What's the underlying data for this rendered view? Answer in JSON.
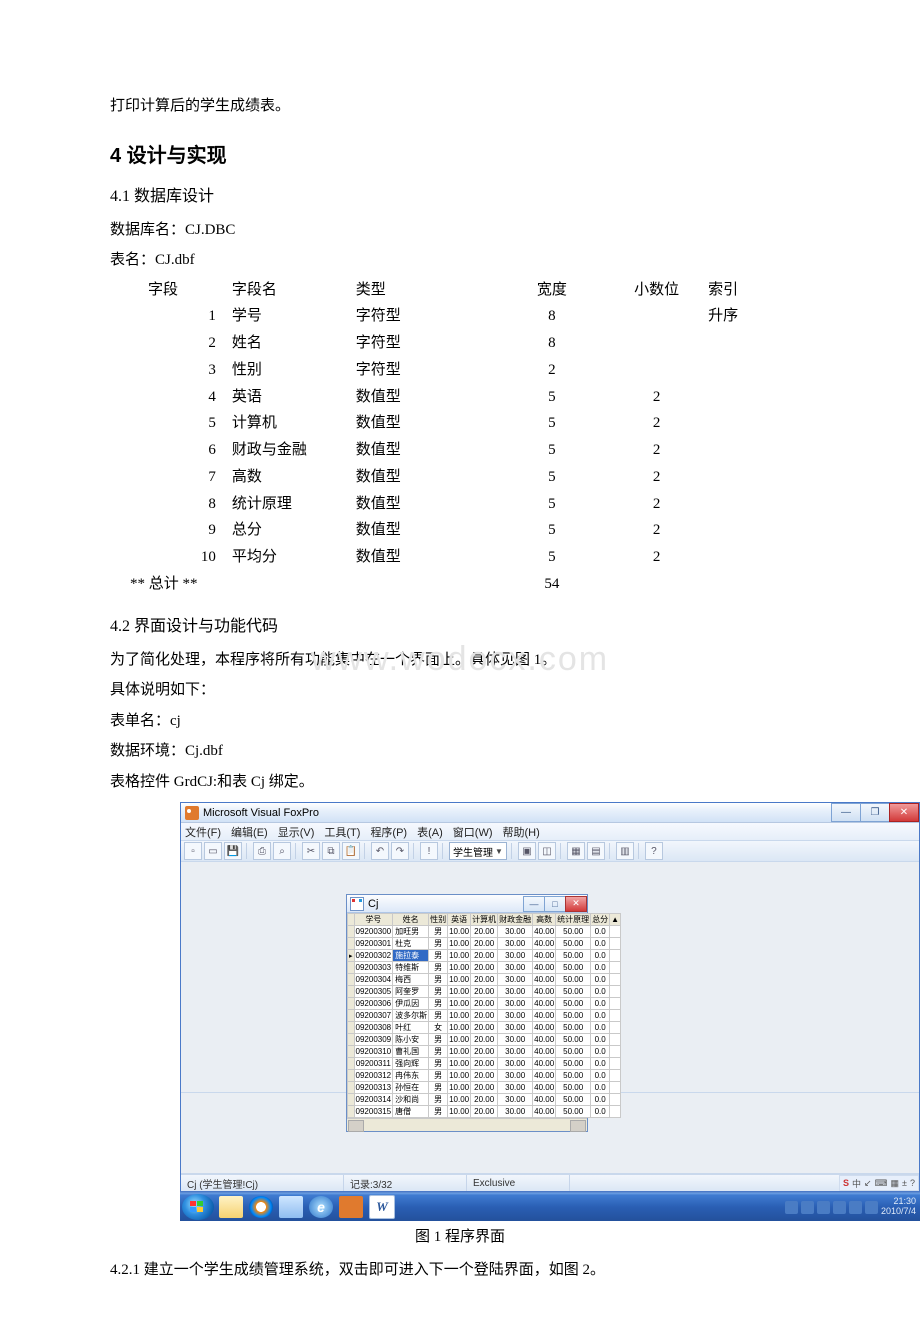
{
  "document": {
    "line_print": "打印计算后的学生成绩表。",
    "h_design": "4  设计与实现",
    "h_db": "4.1  数据库设计",
    "db_name_label": "数据库名：CJ.DBC",
    "table_name_label": "表名：CJ.dbf",
    "fields_header": {
      "col0": "字段",
      "col1": "字段名",
      "col2": "类型",
      "col3": "宽度",
      "col4": "小数位",
      "col5": "索引"
    },
    "fields": [
      {
        "n": "1",
        "name": "学号",
        "type": "字符型",
        "w": "8",
        "d": "",
        "idx": "升序"
      },
      {
        "n": "2",
        "name": "姓名",
        "type": "字符型",
        "w": "8",
        "d": "",
        "idx": ""
      },
      {
        "n": "3",
        "name": "性别",
        "type": "字符型",
        "w": "2",
        "d": "",
        "idx": ""
      },
      {
        "n": "4",
        "name": "英语",
        "type": "数值型",
        "w": "5",
        "d": "2",
        "idx": ""
      },
      {
        "n": "5",
        "name": "计算机",
        "type": "数值型",
        "w": "5",
        "d": "2",
        "idx": ""
      },
      {
        "n": "6",
        "name": "财政与金融",
        "type": "数值型",
        "w": "5",
        "d": "2",
        "idx": ""
      },
      {
        "n": "7",
        "name": "高数",
        "type": "数值型",
        "w": "5",
        "d": "2",
        "idx": ""
      },
      {
        "n": "8",
        "name": "统计原理",
        "type": "数值型",
        "w": "5",
        "d": "2",
        "idx": ""
      },
      {
        "n": "9",
        "name": "总分",
        "type": "数值型",
        "w": "5",
        "d": "2",
        "idx": ""
      },
      {
        "n": "10",
        "name": "平均分",
        "type": "数值型",
        "w": "5",
        "d": "2",
        "idx": ""
      }
    ],
    "total_row": {
      "label": "**  总计  **",
      "w": "54"
    },
    "h_ui": "4.2  界面设计与功能代码",
    "p_ui1": "为了简化处理，本程序将所有功能集中在一个界面上。具体见图 1。",
    "p_ui2": "具体说明如下：",
    "p_ui3": "表单名：cj",
    "p_ui4": "数据环境：Cj.dbf",
    "p_ui5": "表格控件 GrdCJ:和表 Cj 绑定。",
    "watermark": "www.wodocx.com",
    "figcap": "图 1    程序界面",
    "p_421": "4.2.1  建立一个学生成绩管理系统，双击即可进入下一个登陆界面，如图 2。"
  },
  "vfp": {
    "title": "Microsoft Visual FoxPro",
    "menu": [
      "文件(F)",
      "编辑(E)",
      "显示(V)",
      "工具(T)",
      "程序(P)",
      "表(A)",
      "窗口(W)",
      "帮助(H)"
    ],
    "combo": "学生管理",
    "status_left": "Cj (学生管理!Cj)",
    "status_rec": "记录:3/32",
    "status_mode": "Exclusive",
    "lang": {
      "s": "S",
      "ch": "中"
    },
    "tray_time": "21:30",
    "tray_date": "2010/7/4",
    "cj_title": "Cj",
    "grid_headers": [
      "",
      "学号",
      "姓名",
      "性别",
      "英语",
      "计算机",
      "财政金融",
      "高数",
      "统计原理",
      "总分"
    ],
    "grid_rows": [
      {
        "id": "09200300",
        "name": "加旺男",
        "sex": "男",
        "a": "10.00",
        "b": "20.00",
        "c": "30.00",
        "d": "40.00",
        "e": "50.00",
        "f": "0.0"
      },
      {
        "id": "09200301",
        "name": "杜克",
        "sex": "男",
        "a": "10.00",
        "b": "20.00",
        "c": "30.00",
        "d": "40.00",
        "e": "50.00",
        "f": "0.0"
      },
      {
        "id": "09200302",
        "name": "施拉泰",
        "sex": "男",
        "a": "10.00",
        "b": "20.00",
        "c": "30.00",
        "d": "40.00",
        "e": "50.00",
        "f": "0.0",
        "sel": true
      },
      {
        "id": "09200303",
        "name": "特维斯",
        "sex": "男",
        "a": "10.00",
        "b": "20.00",
        "c": "30.00",
        "d": "40.00",
        "e": "50.00",
        "f": "0.0"
      },
      {
        "id": "09200304",
        "name": "梅西",
        "sex": "男",
        "a": "10.00",
        "b": "20.00",
        "c": "30.00",
        "d": "40.00",
        "e": "50.00",
        "f": "0.0"
      },
      {
        "id": "09200305",
        "name": "阿奎罗",
        "sex": "男",
        "a": "10.00",
        "b": "20.00",
        "c": "30.00",
        "d": "40.00",
        "e": "50.00",
        "f": "0.0"
      },
      {
        "id": "09200306",
        "name": "伊瓜因",
        "sex": "男",
        "a": "10.00",
        "b": "20.00",
        "c": "30.00",
        "d": "40.00",
        "e": "50.00",
        "f": "0.0"
      },
      {
        "id": "09200307",
        "name": "波多尔斯",
        "sex": "男",
        "a": "10.00",
        "b": "20.00",
        "c": "30.00",
        "d": "40.00",
        "e": "50.00",
        "f": "0.0"
      },
      {
        "id": "09200308",
        "name": "叶红",
        "sex": "女",
        "a": "10.00",
        "b": "20.00",
        "c": "30.00",
        "d": "40.00",
        "e": "50.00",
        "f": "0.0"
      },
      {
        "id": "09200309",
        "name": "陈小安",
        "sex": "男",
        "a": "10.00",
        "b": "20.00",
        "c": "30.00",
        "d": "40.00",
        "e": "50.00",
        "f": "0.0"
      },
      {
        "id": "09200310",
        "name": "曹礼国",
        "sex": "男",
        "a": "10.00",
        "b": "20.00",
        "c": "30.00",
        "d": "40.00",
        "e": "50.00",
        "f": "0.0"
      },
      {
        "id": "09200311",
        "name": "强向辉",
        "sex": "男",
        "a": "10.00",
        "b": "20.00",
        "c": "30.00",
        "d": "40.00",
        "e": "50.00",
        "f": "0.0"
      },
      {
        "id": "09200312",
        "name": "冉伟东",
        "sex": "男",
        "a": "10.00",
        "b": "20.00",
        "c": "30.00",
        "d": "40.00",
        "e": "50.00",
        "f": "0.0"
      },
      {
        "id": "09200313",
        "name": "孙恒在",
        "sex": "男",
        "a": "10.00",
        "b": "20.00",
        "c": "30.00",
        "d": "40.00",
        "e": "50.00",
        "f": "0.0"
      },
      {
        "id": "09200314",
        "name": "沙和尚",
        "sex": "男",
        "a": "10.00",
        "b": "20.00",
        "c": "30.00",
        "d": "40.00",
        "e": "50.00",
        "f": "0.0"
      },
      {
        "id": "09200315",
        "name": "唐僧",
        "sex": "男",
        "a": "10.00",
        "b": "20.00",
        "c": "30.00",
        "d": "40.00",
        "e": "50.00",
        "f": "0.0"
      }
    ]
  }
}
